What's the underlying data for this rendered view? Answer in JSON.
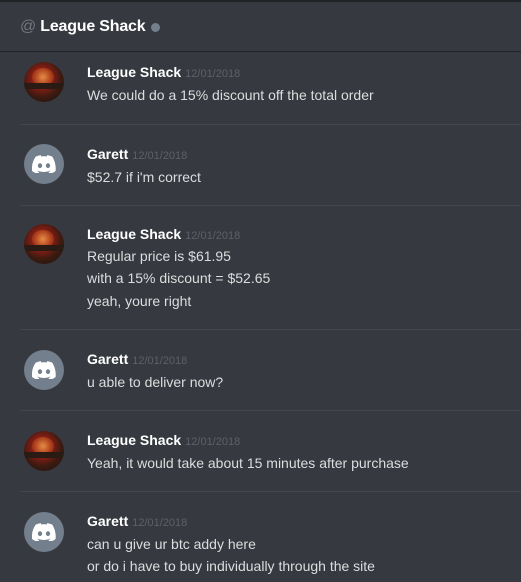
{
  "header": {
    "at_sign": "@",
    "title": "League Shack"
  },
  "messages": [
    {
      "author": "League Shack",
      "timestamp": "12/01/2018",
      "avatar": "league-shack-avatar",
      "lines": [
        "We could do a 15% discount off the total order"
      ]
    },
    {
      "author": "Garett",
      "timestamp": "12/01/2018",
      "avatar": "discord-default-avatar",
      "lines": [
        "$52.7 if i'm correct"
      ]
    },
    {
      "author": "League Shack",
      "timestamp": "12/01/2018",
      "avatar": "league-shack-avatar",
      "lines": [
        "Regular price is $61.95",
        "with a 15% discount = $52.65",
        "yeah, youre right"
      ]
    },
    {
      "author": "Garett",
      "timestamp": "12/01/2018",
      "avatar": "discord-default-avatar",
      "lines": [
        "u able to deliver now?"
      ]
    },
    {
      "author": "League Shack",
      "timestamp": "12/01/2018",
      "avatar": "league-shack-avatar",
      "lines": [
        "Yeah, it would take about 15 minutes after purchase"
      ]
    },
    {
      "author": "Garett",
      "timestamp": "12/01/2018",
      "avatar": "discord-default-avatar",
      "lines": [
        "can u give ur btc addy here",
        "or do i have to buy individually through the site"
      ]
    }
  ],
  "colors": {
    "background": "#36393f",
    "author": "#ffffff",
    "text": "#dcddde",
    "timestamp": "#5d6167",
    "default_avatar": "#747f8d",
    "status_offline": "#747f8d"
  }
}
